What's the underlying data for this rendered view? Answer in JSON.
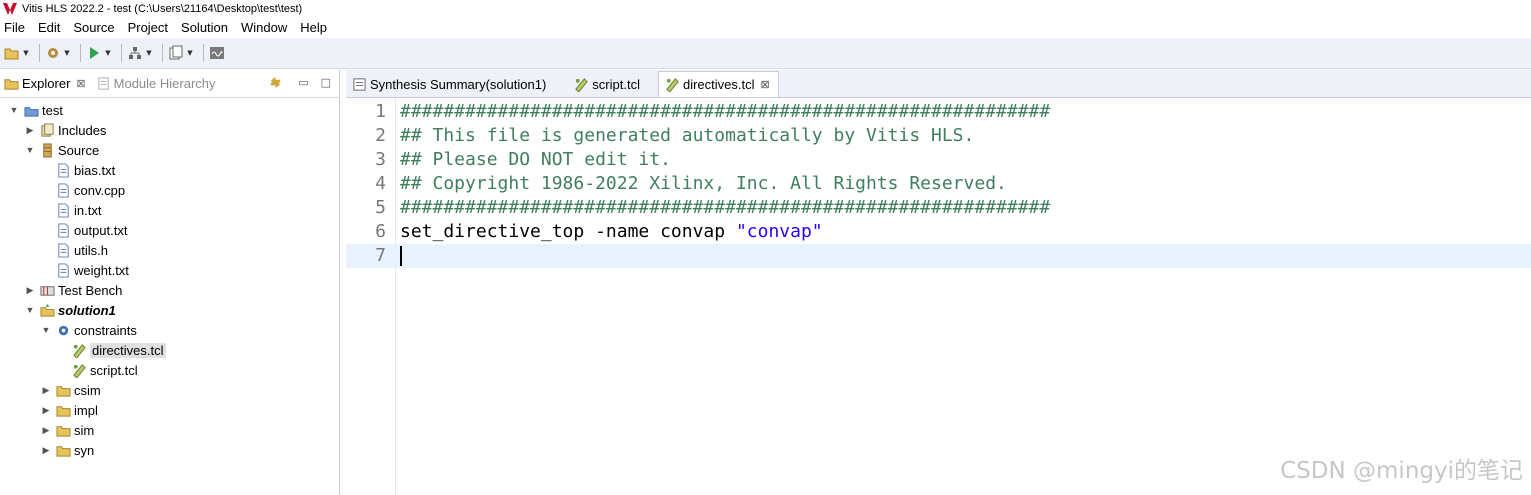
{
  "window": {
    "title": "Vitis HLS 2022.2 - test (C:\\Users\\21164\\Desktop\\test\\test)"
  },
  "menu": [
    "File",
    "Edit",
    "Source",
    "Project",
    "Solution",
    "Window",
    "Help"
  ],
  "left_panel": {
    "tabs": [
      {
        "label": "Explorer",
        "close": "⊠"
      },
      {
        "label": "Module Hierarchy"
      }
    ],
    "tree": {
      "project": "test",
      "includes": "Includes",
      "source": "Source",
      "source_files": [
        "bias.txt",
        "conv.cpp",
        "in.txt",
        "output.txt",
        "utils.h",
        "weight.txt"
      ],
      "test_bench": "Test Bench",
      "solution": "solution1",
      "constraints": "constraints",
      "constraint_files": [
        "directives.tcl",
        "script.tcl"
      ],
      "folders": [
        "csim",
        "impl",
        "sim",
        "syn"
      ]
    }
  },
  "editor": {
    "tabs": [
      {
        "label": "Synthesis Summary(solution1)"
      },
      {
        "label": "script.tcl"
      },
      {
        "label": "directives.tcl",
        "close": "⊠"
      }
    ],
    "lines": [
      {
        "n": "1",
        "text": "############################################################"
      },
      {
        "n": "2",
        "text": "## This file is generated automatically by Vitis HLS."
      },
      {
        "n": "3",
        "text": "## Please DO NOT edit it."
      },
      {
        "n": "4",
        "text": "## Copyright 1986-2022 Xilinx, Inc. All Rights Reserved."
      },
      {
        "n": "5",
        "text": "############################################################"
      },
      {
        "n": "6",
        "text": "set_directive_top -name convap ",
        "string": "\"convap\""
      },
      {
        "n": "7",
        "text": ""
      }
    ]
  },
  "watermark": "CSDN @mingyi的笔记",
  "colors": {
    "comment": "#3f7f5f",
    "string": "#2a00ff",
    "current_line": "#e8f2fe",
    "toolbar_bg": "#eef1f8"
  }
}
